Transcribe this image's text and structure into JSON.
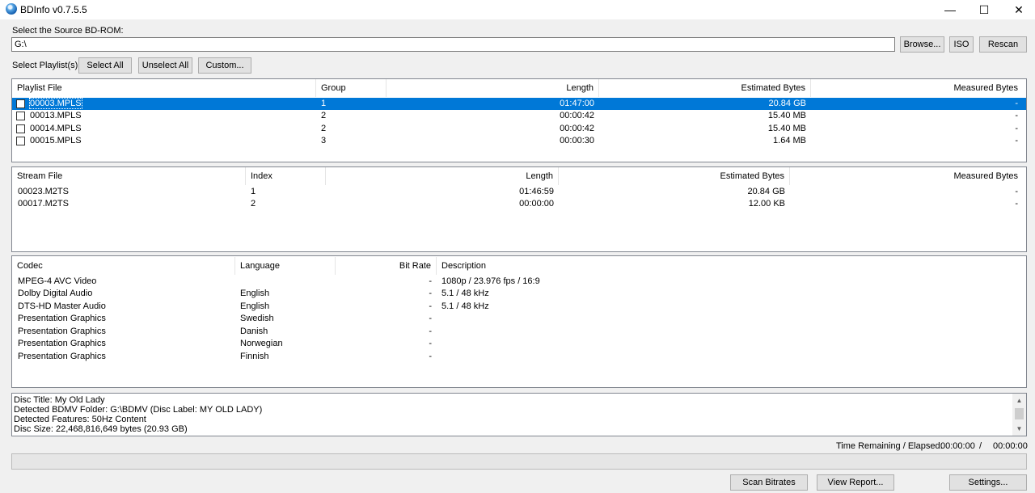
{
  "window": {
    "title": "BDInfo v0.7.5.5",
    "minimize": "—",
    "maximize": "☐",
    "close": "✕"
  },
  "source": {
    "label": "Select the Source BD-ROM:",
    "path": "G:\\",
    "browse": "Browse...",
    "iso": "ISO",
    "rescan": "Rescan"
  },
  "playlist_select": {
    "label": "Select Playlist(s):",
    "select_all": "Select All",
    "unselect_all": "Unselect All",
    "custom": "Custom..."
  },
  "playlists": {
    "columns": [
      "Playlist File",
      "Group",
      "Length",
      "Estimated Bytes",
      "Measured Bytes"
    ],
    "rows": [
      {
        "file": "00003.MPLS",
        "group": "1",
        "length": "01:47:00",
        "estimated": "20.84 GB",
        "measured": "-",
        "selected": true,
        "checked": false
      },
      {
        "file": "00013.MPLS",
        "group": "2",
        "length": "00:00:42",
        "estimated": "15.40 MB",
        "measured": "-",
        "selected": false,
        "checked": false
      },
      {
        "file": "00014.MPLS",
        "group": "2",
        "length": "00:00:42",
        "estimated": "15.40 MB",
        "measured": "-",
        "selected": false,
        "checked": false
      },
      {
        "file": "00015.MPLS",
        "group": "3",
        "length": "00:00:30",
        "estimated": "1.64 MB",
        "measured": "-",
        "selected": false,
        "checked": false
      }
    ]
  },
  "streams": {
    "columns": [
      "Stream File",
      "Index",
      "Length",
      "Estimated Bytes",
      "Measured Bytes"
    ],
    "rows": [
      {
        "file": "00023.M2TS",
        "index": "1",
        "length": "01:46:59",
        "estimated": "20.84 GB",
        "measured": "-"
      },
      {
        "file": "00017.M2TS",
        "index": "2",
        "length": "00:00:00",
        "estimated": "12.00 KB",
        "measured": "-"
      }
    ]
  },
  "codecs": {
    "columns": [
      "Codec",
      "Language",
      "Bit Rate",
      "Description"
    ],
    "rows": [
      {
        "codec": "MPEG-4 AVC Video",
        "language": "",
        "bitrate": "-",
        "description": "1080p / 23.976 fps / 16:9"
      },
      {
        "codec": "Dolby Digital Audio",
        "language": "English",
        "bitrate": "-",
        "description": "5.1 / 48 kHz"
      },
      {
        "codec": "DTS-HD Master Audio",
        "language": "English",
        "bitrate": "-",
        "description": "5.1 / 48 kHz"
      },
      {
        "codec": "Presentation Graphics",
        "language": "Swedish",
        "bitrate": "-",
        "description": ""
      },
      {
        "codec": "Presentation Graphics",
        "language": "Danish",
        "bitrate": "-",
        "description": ""
      },
      {
        "codec": "Presentation Graphics",
        "language": "Norwegian",
        "bitrate": "-",
        "description": ""
      },
      {
        "codec": "Presentation Graphics",
        "language": "Finnish",
        "bitrate": "-",
        "description": ""
      }
    ]
  },
  "log": {
    "lines": [
      "Disc Title: My Old Lady",
      "Detected BDMV Folder: G:\\BDMV (Disc Label: MY OLD LADY)",
      "Detected Features: 50Hz Content",
      "Disc Size: 22,468,816,649 bytes (20.93 GB)"
    ]
  },
  "status": {
    "time_label": "Time Remaining / Elapsed:",
    "remaining": "00:00:00",
    "separator": "/",
    "elapsed": "00:00:00",
    "progress_fraction": 0
  },
  "footer": {
    "scan_bitrates": "Scan Bitrates",
    "view_report": "View Report...",
    "settings": "Settings..."
  },
  "colors": {
    "selection": "#0078d7",
    "progress": "#06b025"
  }
}
